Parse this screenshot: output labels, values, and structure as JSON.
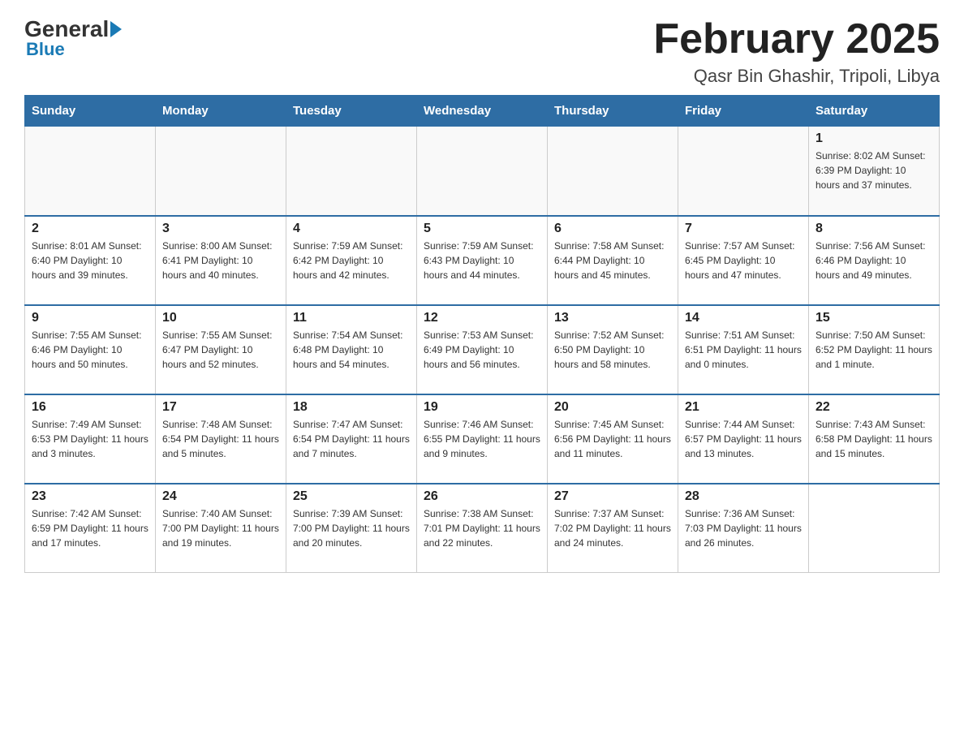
{
  "logo": {
    "general": "General",
    "blue": "Blue"
  },
  "title": "February 2025",
  "location": "Qasr Bin Ghashir, Tripoli, Libya",
  "days_of_week": [
    "Sunday",
    "Monday",
    "Tuesday",
    "Wednesday",
    "Thursday",
    "Friday",
    "Saturday"
  ],
  "weeks": [
    [
      {
        "day": "",
        "info": ""
      },
      {
        "day": "",
        "info": ""
      },
      {
        "day": "",
        "info": ""
      },
      {
        "day": "",
        "info": ""
      },
      {
        "day": "",
        "info": ""
      },
      {
        "day": "",
        "info": ""
      },
      {
        "day": "1",
        "info": "Sunrise: 8:02 AM\nSunset: 6:39 PM\nDaylight: 10 hours\nand 37 minutes."
      }
    ],
    [
      {
        "day": "2",
        "info": "Sunrise: 8:01 AM\nSunset: 6:40 PM\nDaylight: 10 hours\nand 39 minutes."
      },
      {
        "day": "3",
        "info": "Sunrise: 8:00 AM\nSunset: 6:41 PM\nDaylight: 10 hours\nand 40 minutes."
      },
      {
        "day": "4",
        "info": "Sunrise: 7:59 AM\nSunset: 6:42 PM\nDaylight: 10 hours\nand 42 minutes."
      },
      {
        "day": "5",
        "info": "Sunrise: 7:59 AM\nSunset: 6:43 PM\nDaylight: 10 hours\nand 44 minutes."
      },
      {
        "day": "6",
        "info": "Sunrise: 7:58 AM\nSunset: 6:44 PM\nDaylight: 10 hours\nand 45 minutes."
      },
      {
        "day": "7",
        "info": "Sunrise: 7:57 AM\nSunset: 6:45 PM\nDaylight: 10 hours\nand 47 minutes."
      },
      {
        "day": "8",
        "info": "Sunrise: 7:56 AM\nSunset: 6:46 PM\nDaylight: 10 hours\nand 49 minutes."
      }
    ],
    [
      {
        "day": "9",
        "info": "Sunrise: 7:55 AM\nSunset: 6:46 PM\nDaylight: 10 hours\nand 50 minutes."
      },
      {
        "day": "10",
        "info": "Sunrise: 7:55 AM\nSunset: 6:47 PM\nDaylight: 10 hours\nand 52 minutes."
      },
      {
        "day": "11",
        "info": "Sunrise: 7:54 AM\nSunset: 6:48 PM\nDaylight: 10 hours\nand 54 minutes."
      },
      {
        "day": "12",
        "info": "Sunrise: 7:53 AM\nSunset: 6:49 PM\nDaylight: 10 hours\nand 56 minutes."
      },
      {
        "day": "13",
        "info": "Sunrise: 7:52 AM\nSunset: 6:50 PM\nDaylight: 10 hours\nand 58 minutes."
      },
      {
        "day": "14",
        "info": "Sunrise: 7:51 AM\nSunset: 6:51 PM\nDaylight: 11 hours\nand 0 minutes."
      },
      {
        "day": "15",
        "info": "Sunrise: 7:50 AM\nSunset: 6:52 PM\nDaylight: 11 hours\nand 1 minute."
      }
    ],
    [
      {
        "day": "16",
        "info": "Sunrise: 7:49 AM\nSunset: 6:53 PM\nDaylight: 11 hours\nand 3 minutes."
      },
      {
        "day": "17",
        "info": "Sunrise: 7:48 AM\nSunset: 6:54 PM\nDaylight: 11 hours\nand 5 minutes."
      },
      {
        "day": "18",
        "info": "Sunrise: 7:47 AM\nSunset: 6:54 PM\nDaylight: 11 hours\nand 7 minutes."
      },
      {
        "day": "19",
        "info": "Sunrise: 7:46 AM\nSunset: 6:55 PM\nDaylight: 11 hours\nand 9 minutes."
      },
      {
        "day": "20",
        "info": "Sunrise: 7:45 AM\nSunset: 6:56 PM\nDaylight: 11 hours\nand 11 minutes."
      },
      {
        "day": "21",
        "info": "Sunrise: 7:44 AM\nSunset: 6:57 PM\nDaylight: 11 hours\nand 13 minutes."
      },
      {
        "day": "22",
        "info": "Sunrise: 7:43 AM\nSunset: 6:58 PM\nDaylight: 11 hours\nand 15 minutes."
      }
    ],
    [
      {
        "day": "23",
        "info": "Sunrise: 7:42 AM\nSunset: 6:59 PM\nDaylight: 11 hours\nand 17 minutes."
      },
      {
        "day": "24",
        "info": "Sunrise: 7:40 AM\nSunset: 7:00 PM\nDaylight: 11 hours\nand 19 minutes."
      },
      {
        "day": "25",
        "info": "Sunrise: 7:39 AM\nSunset: 7:00 PM\nDaylight: 11 hours\nand 20 minutes."
      },
      {
        "day": "26",
        "info": "Sunrise: 7:38 AM\nSunset: 7:01 PM\nDaylight: 11 hours\nand 22 minutes."
      },
      {
        "day": "27",
        "info": "Sunrise: 7:37 AM\nSunset: 7:02 PM\nDaylight: 11 hours\nand 24 minutes."
      },
      {
        "day": "28",
        "info": "Sunrise: 7:36 AM\nSunset: 7:03 PM\nDaylight: 11 hours\nand 26 minutes."
      },
      {
        "day": "",
        "info": ""
      }
    ]
  ]
}
